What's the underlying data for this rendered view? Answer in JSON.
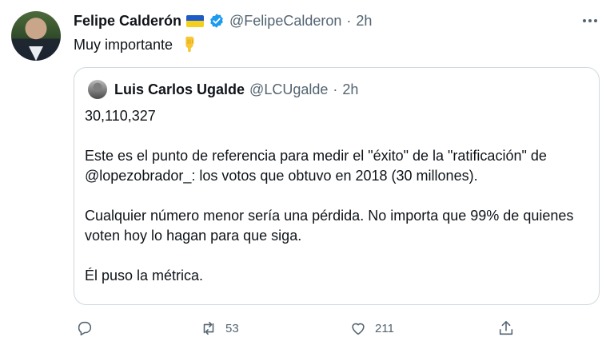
{
  "tweet": {
    "author_name": "Felipe Calderón",
    "author_handle": "@FelipeCalderon",
    "separator": "·",
    "time": "2h",
    "text": "Muy importante"
  },
  "quoted_tweet": {
    "author_name": "Luis Carlos Ugalde",
    "author_handle": "@LCUgalde",
    "separator": "·",
    "time": "2h",
    "paragraphs": [
      "30,110,327",
      "Este es el punto de referencia para medir el \"éxito\" de la \"ratificación\" de @lopezobrador_: los votos que obtuvo en 2018 (30 millones).",
      "Cualquier número menor sería una pérdida. No importa que 99% de quienes voten hoy lo hagan para que siga.",
      "Él puso la métrica."
    ]
  },
  "actions": {
    "retweet_count": "53",
    "like_count": "211"
  },
  "colors": {
    "text_primary": "#0f1419",
    "text_secondary": "#536471",
    "border": "#cfd9de",
    "verified": "#1d9bf0"
  },
  "icons": {
    "flag": "ukraine-flag-icon",
    "verified": "verified-badge-icon",
    "emoji": "backhand-index-pointing-down-icon",
    "reply": "reply-icon",
    "retweet": "retweet-icon",
    "like": "heart-icon",
    "share": "share-icon",
    "more": "more-icon"
  }
}
